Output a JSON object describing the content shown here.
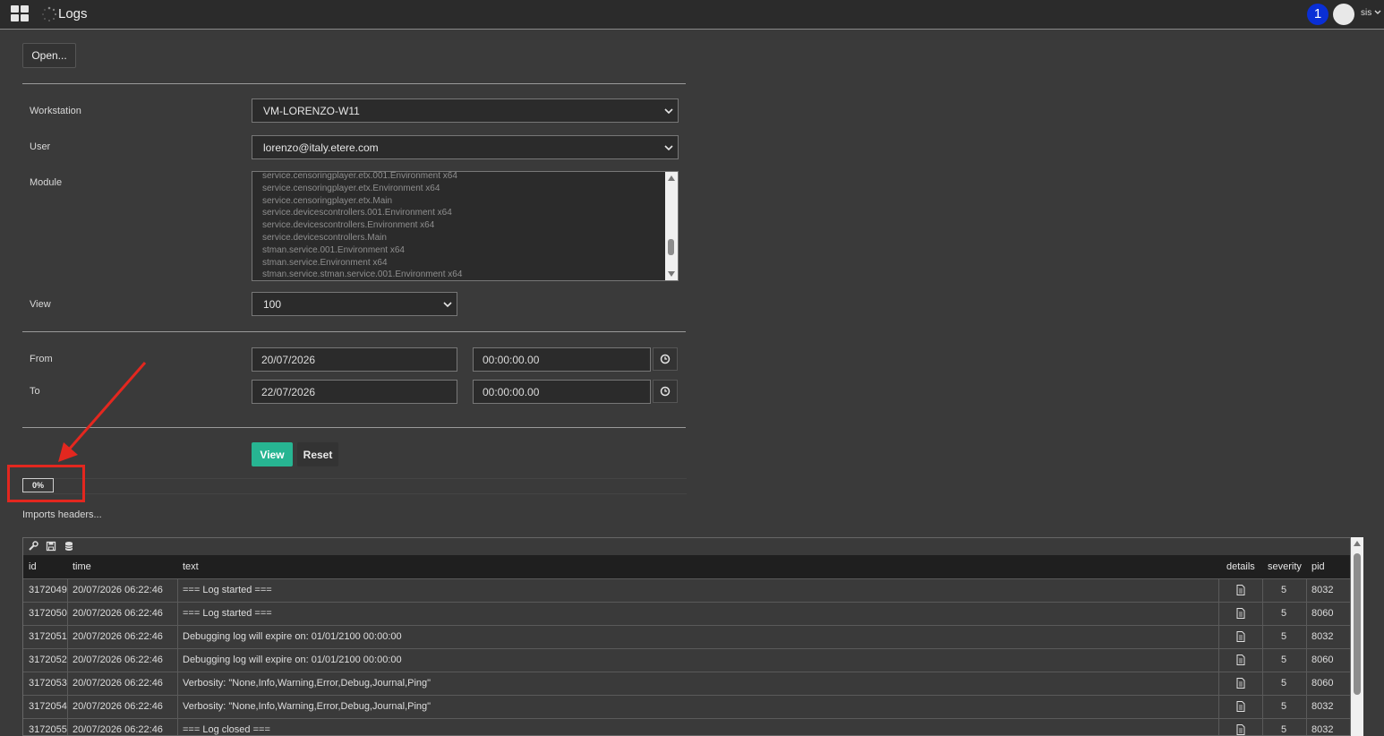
{
  "header": {
    "title": "Logs",
    "notification_count": "1",
    "user": "sis"
  },
  "toolbar": {
    "open_label": "Open..."
  },
  "form": {
    "workstation": {
      "label": "Workstation",
      "value": "VM-LORENZO-W11"
    },
    "user": {
      "label": "User",
      "value": "lorenzo@italy.etere.com"
    },
    "module": {
      "label": "Module",
      "items": [
        "service.censoringplayer.etx.001.Environment x64",
        "service.censoringplayer.etx.Environment x64",
        "service.censoringplayer.etx.Main",
        "service.devicescontrollers.001.Environment x64",
        "service.devicescontrollers.Environment x64",
        "service.devicescontrollers.Main",
        "stman.service.001.Environment x64",
        "stman.service.Environment x64",
        "stman.service.stman.service.001.Environment x64"
      ]
    },
    "view": {
      "label": "View",
      "value": "100"
    },
    "from": {
      "label": "From",
      "date": "20/07/2026",
      "time": "00:00:00.00"
    },
    "to": {
      "label": "To",
      "date": "22/07/2026",
      "time": "00:00:00.00"
    },
    "view_button": "View",
    "reset_button": "Reset"
  },
  "progress": {
    "percent_text": "0%",
    "value": 0,
    "status": "Imports headers..."
  },
  "grid": {
    "columns": [
      "id",
      "time",
      "text",
      "details",
      "severity",
      "pid"
    ],
    "rows": [
      {
        "id": "3172049",
        "time": "20/07/2026 06:22:46",
        "text": "=== Log started ===",
        "severity": "5",
        "pid": "8032"
      },
      {
        "id": "3172050",
        "time": "20/07/2026 06:22:46",
        "text": "=== Log started ===",
        "severity": "5",
        "pid": "8060"
      },
      {
        "id": "3172051",
        "time": "20/07/2026 06:22:46",
        "text": "Debugging log will expire on: 01/01/2100 00:00:00",
        "severity": "5",
        "pid": "8032"
      },
      {
        "id": "3172052",
        "time": "20/07/2026 06:22:46",
        "text": "Debugging log will expire on: 01/01/2100 00:00:00",
        "severity": "5",
        "pid": "8060"
      },
      {
        "id": "3172053",
        "time": "20/07/2026 06:22:46",
        "text": "Verbosity: \"None,Info,Warning,Error,Debug,Journal,Ping\"",
        "severity": "5",
        "pid": "8060"
      },
      {
        "id": "3172054",
        "time": "20/07/2026 06:22:46",
        "text": "Verbosity: \"None,Info,Warning,Error,Debug,Journal,Ping\"",
        "severity": "5",
        "pid": "8032"
      },
      {
        "id": "3172055",
        "time": "20/07/2026 06:22:46",
        "text": "=== Log closed ===",
        "severity": "5",
        "pid": "8032"
      }
    ]
  },
  "colors": {
    "accent": "#27b592",
    "highlight": "#e3271f",
    "badge": "#0a2fd6"
  }
}
